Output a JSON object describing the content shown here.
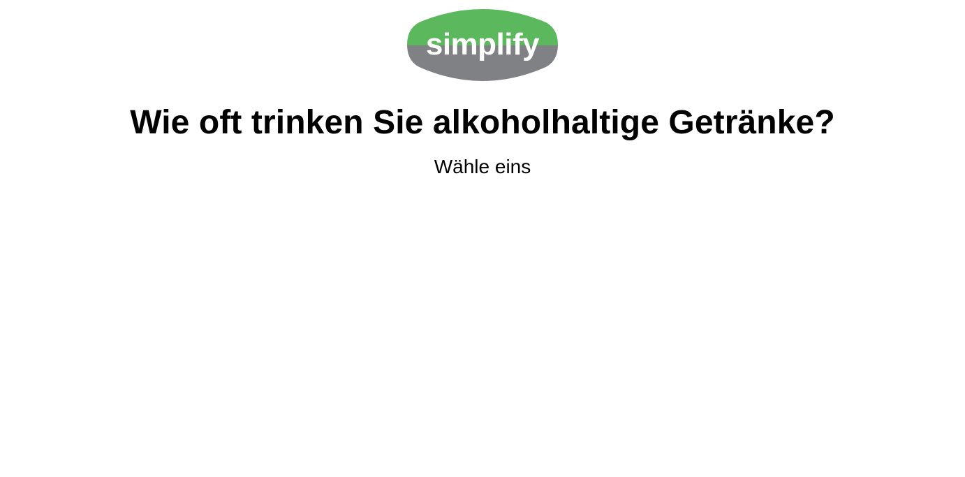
{
  "logo": {
    "text": "simplify",
    "colors": {
      "top": "#5cb85c",
      "bottom": "#808184",
      "text": "#ffffff"
    }
  },
  "question": {
    "title": "Wie oft trinken Sie alkoholhaltige Getränke?",
    "subtitle": "Wähle eins"
  }
}
